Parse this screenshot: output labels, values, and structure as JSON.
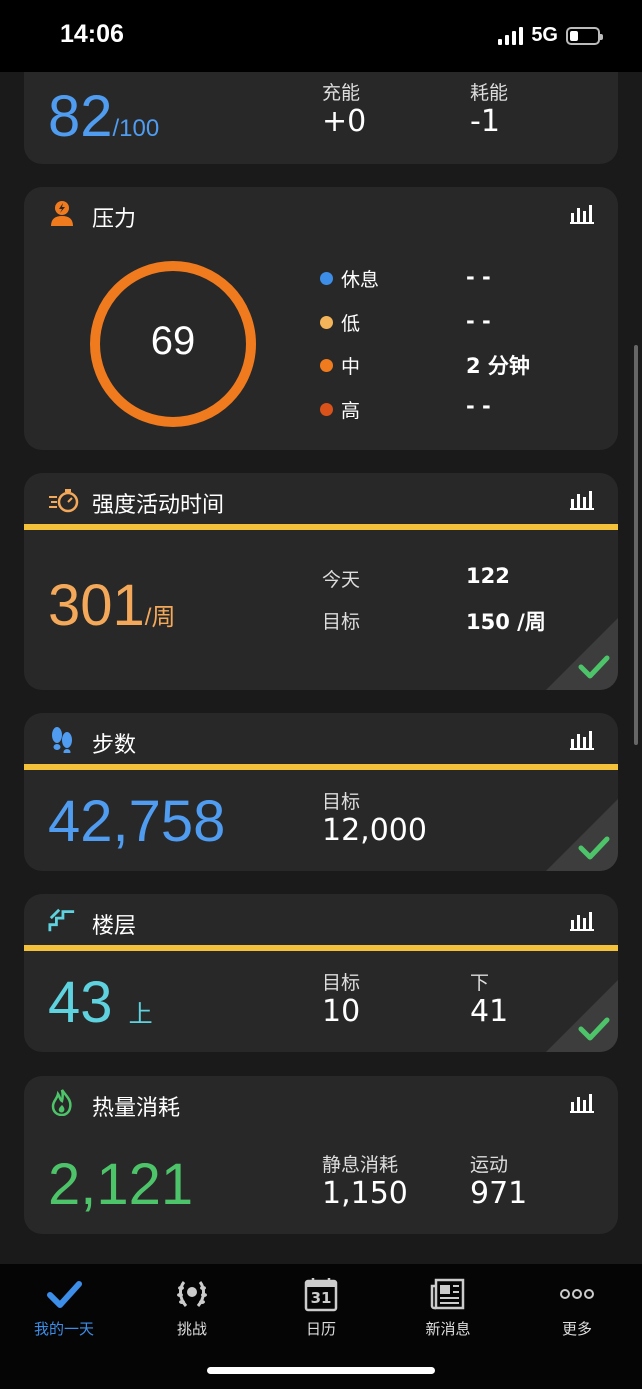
{
  "status": {
    "time": "14:06",
    "network": "5G"
  },
  "body_battery": {
    "value": "82",
    "unit": "/100",
    "charge_label": "充能",
    "charge_value": "+0",
    "drain_label": "耗能",
    "drain_value": "-1"
  },
  "stress": {
    "title": "压力",
    "value": "69",
    "legend": [
      {
        "label": "休息",
        "value": "- -",
        "color": "#3d8ee8"
      },
      {
        "label": "低",
        "value": "- -",
        "color": "#f4b55a"
      },
      {
        "label": "中",
        "value": "2 分钟",
        "color": "#f07a1e"
      },
      {
        "label": "高",
        "value": "- -",
        "color": "#d8521a"
      }
    ]
  },
  "intensity": {
    "title": "强度活动时间",
    "value": "301",
    "unit": "/周",
    "today_label": "今天",
    "today_value": "122",
    "goal_label": "目标",
    "goal_value": "150 /周"
  },
  "steps": {
    "title": "步数",
    "value": "42,758",
    "goal_label": "目标",
    "goal_value": "12,000"
  },
  "floors": {
    "title": "楼层",
    "value": "43",
    "unit": "上",
    "goal_label": "目标",
    "goal_value": "10",
    "down_label": "下",
    "down_value": "41"
  },
  "calories": {
    "title": "热量消耗",
    "value": "2,121",
    "resting_label": "静息消耗",
    "resting_value": "1,150",
    "active_label": "运动",
    "active_value": "971"
  },
  "tabs": [
    {
      "label": "我的一天",
      "icon": "check-icon",
      "active": true
    },
    {
      "label": "挑战",
      "icon": "laurel-icon"
    },
    {
      "label": "日历",
      "icon": "calendar-icon",
      "day": "31"
    },
    {
      "label": "新消息",
      "icon": "news-icon"
    },
    {
      "label": "更多",
      "icon": "more-icon"
    }
  ],
  "colors": {
    "blue": "#4f9cf0",
    "orange": "#f07a1e",
    "light_orange": "#f4a85a",
    "teal": "#5fd2e0",
    "green": "#4ec46a",
    "yellow": "#f4c13a"
  }
}
